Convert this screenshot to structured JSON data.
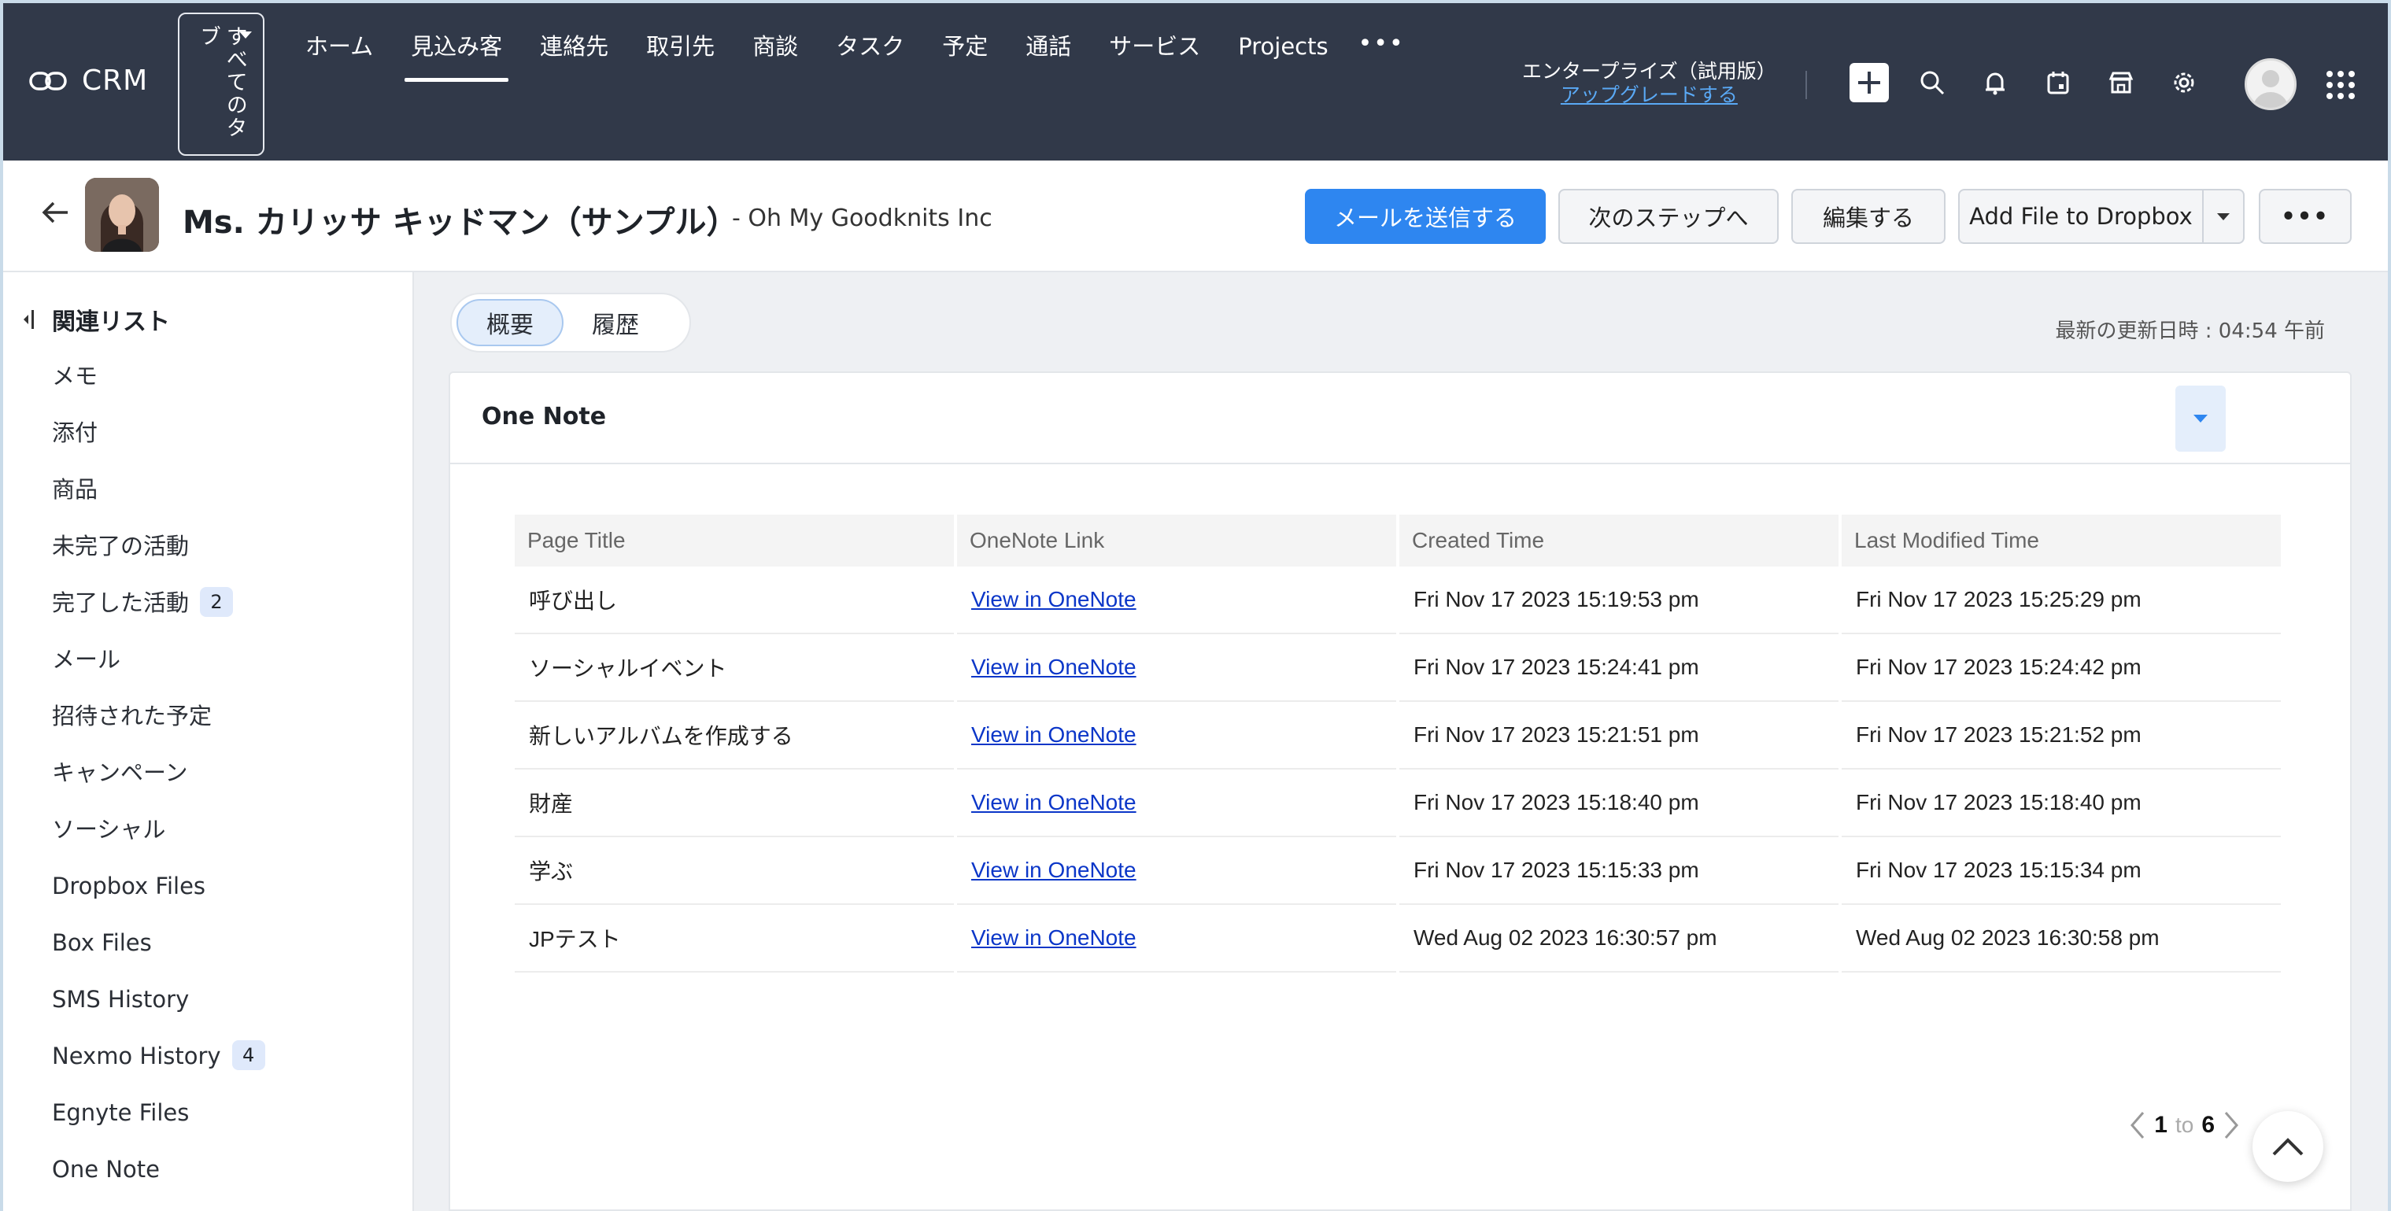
{
  "app": {
    "logo_text": "CRM"
  },
  "nav": {
    "all_tabs_label": "すべてのタブ",
    "tabs": [
      {
        "label": "ホーム",
        "active": false
      },
      {
        "label": "見込み客",
        "active": true
      },
      {
        "label": "連絡先",
        "active": false
      },
      {
        "label": "取引先",
        "active": false
      },
      {
        "label": "商談",
        "active": false
      },
      {
        "label": "タスク",
        "active": false
      },
      {
        "label": "予定",
        "active": false
      },
      {
        "label": "通話",
        "active": false
      },
      {
        "label": "サービス",
        "active": false
      },
      {
        "label": "Projects",
        "active": false
      }
    ],
    "more_label": "•••",
    "edition": "エンタープライズ（試用版）",
    "upgrade_link": "アップグレードする",
    "icons": [
      "plus-icon",
      "search-icon",
      "bell-icon",
      "calendar-icon",
      "store-icon",
      "gear-icon",
      "avatar",
      "apps-grid-icon"
    ]
  },
  "header": {
    "name": "Ms. カリッサ キッドマン（サンプル）",
    "company": "- Oh My Goodknits Inc",
    "buttons": {
      "send_mail": "メールを送信する",
      "next_step": "次のステップへ",
      "edit": "編集する",
      "dropbox": "Add File to Dropbox",
      "more": "•••"
    },
    "accent_color": "#2e86f0"
  },
  "sidebar": {
    "title": "関連リスト",
    "items": [
      {
        "label": "メモ",
        "badge": ""
      },
      {
        "label": "添付",
        "badge": ""
      },
      {
        "label": "商品",
        "badge": ""
      },
      {
        "label": "未完了の活動",
        "badge": ""
      },
      {
        "label": "完了した活動",
        "badge": "2"
      },
      {
        "label": "メール",
        "badge": ""
      },
      {
        "label": "招待された予定",
        "badge": ""
      },
      {
        "label": "キャンペーン",
        "badge": ""
      },
      {
        "label": "ソーシャル",
        "badge": ""
      },
      {
        "label": "Dropbox Files",
        "badge": ""
      },
      {
        "label": "Box Files",
        "badge": ""
      },
      {
        "label": "SMS History",
        "badge": ""
      },
      {
        "label": "Nexmo History",
        "badge": "4"
      },
      {
        "label": "Egnyte Files",
        "badge": ""
      },
      {
        "label": "One Note",
        "badge": ""
      }
    ]
  },
  "main": {
    "tabs": {
      "overview": "概要",
      "history": "履歴"
    },
    "last_updated": "最新の更新日時 : 04:54 午前",
    "section_title": "One Note",
    "table": {
      "columns": [
        "Page Title",
        "OneNote Link",
        "Created Time",
        "Last Modified Time"
      ],
      "rows": [
        {
          "title": "呼び出し",
          "link": "View in OneNote",
          "created": "Fri Nov 17 2023 15:19:53 pm",
          "modified": "Fri Nov 17 2023 15:25:29 pm"
        },
        {
          "title": "ソーシャルイベント",
          "link": "View in OneNote",
          "created": "Fri Nov 17 2023 15:24:41 pm",
          "modified": "Fri Nov 17 2023 15:24:42 pm"
        },
        {
          "title": "新しいアルバムを作成する",
          "link": "View in OneNote",
          "created": "Fri Nov 17 2023 15:21:51 pm",
          "modified": "Fri Nov 17 2023 15:21:52 pm"
        },
        {
          "title": "財産",
          "link": "View in OneNote",
          "created": "Fri Nov 17 2023 15:18:40 pm",
          "modified": "Fri Nov 17 2023 15:18:40 pm"
        },
        {
          "title": "学ぶ",
          "link": "View in OneNote",
          "created": "Fri Nov 17 2023 15:15:33 pm",
          "modified": "Fri Nov 17 2023 15:15:34 pm"
        },
        {
          "title": "JPテスト",
          "link": "View in OneNote",
          "created": "Wed Aug 02 2023 16:30:57 pm",
          "modified": "Wed Aug 02 2023 16:30:58 pm"
        }
      ]
    },
    "pager": {
      "from": "1",
      "to_label": "to",
      "to": "6"
    }
  }
}
